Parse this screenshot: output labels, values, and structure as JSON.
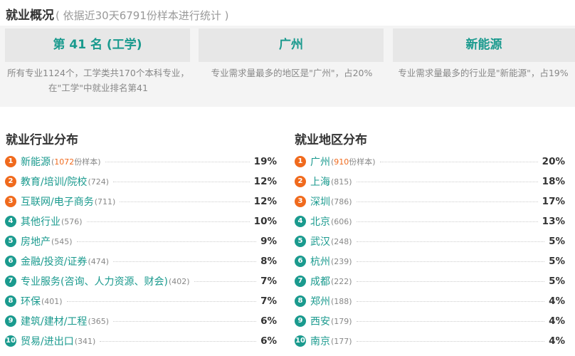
{
  "header": {
    "title": "就业概况",
    "subtitle": "( 依据近30天6791份样本进行统计 )"
  },
  "summary": {
    "cards": [
      {
        "value": "第 41 名 (工学)",
        "desc": "所有专业1124个，工学类共170个本科专业，在\"工学\"中就业排名第41"
      },
      {
        "value": "广州",
        "desc": "专业需求量最多的地区是\"广州\"，占20%"
      },
      {
        "value": "新能源",
        "desc": "专业需求量最多的行业是\"新能源\"，占19%"
      }
    ]
  },
  "industry": {
    "title": "就业行业分布",
    "items": [
      {
        "rank": "1",
        "name": "新能源",
        "count_num": "1072",
        "count_suffix": "份样本",
        "pct": "19%"
      },
      {
        "rank": "2",
        "name": "教育/培训/院校",
        "count": "(724)",
        "pct": "12%"
      },
      {
        "rank": "3",
        "name": "互联网/电子商务",
        "count": "(711)",
        "pct": "12%"
      },
      {
        "rank": "4",
        "name": "其他行业",
        "count": "(576)",
        "pct": "10%"
      },
      {
        "rank": "5",
        "name": "房地产",
        "count": "(545)",
        "pct": "9%"
      },
      {
        "rank": "6",
        "name": "金融/投资/证券",
        "count": "(474)",
        "pct": "8%"
      },
      {
        "rank": "7",
        "name": "专业服务(咨询、人力资源、财会)",
        "count": "(402)",
        "pct": "7%"
      },
      {
        "rank": "8",
        "name": "环保",
        "count": "(401)",
        "pct": "7%"
      },
      {
        "rank": "9",
        "name": "建筑/建材/工程",
        "count": "(365)",
        "pct": "6%"
      },
      {
        "rank": "10",
        "name": "贸易/进出口",
        "count": "(341)",
        "pct": "6%"
      }
    ]
  },
  "region": {
    "title": "就业地区分布",
    "items": [
      {
        "rank": "1",
        "name": "广州",
        "count_num": "910",
        "count_suffix": "份样本",
        "pct": "20%"
      },
      {
        "rank": "2",
        "name": "上海",
        "count": "(815)",
        "pct": "18%"
      },
      {
        "rank": "3",
        "name": "深圳",
        "count": "(786)",
        "pct": "17%"
      },
      {
        "rank": "4",
        "name": "北京",
        "count": "(606)",
        "pct": "13%"
      },
      {
        "rank": "5",
        "name": "武汉",
        "count": "(248)",
        "pct": "5%"
      },
      {
        "rank": "6",
        "name": "杭州",
        "count": "(239)",
        "pct": "5%"
      },
      {
        "rank": "7",
        "name": "成都",
        "count": "(222)",
        "pct": "5%"
      },
      {
        "rank": "8",
        "name": "郑州",
        "count": "(188)",
        "pct": "4%"
      },
      {
        "rank": "9",
        "name": "西安",
        "count": "(179)",
        "pct": "4%"
      },
      {
        "rank": "10",
        "name": "南京",
        "count": "(177)",
        "pct": "4%"
      }
    ]
  },
  "colors": {
    "accent_teal": "#1a9a8e",
    "accent_orange": "#f06a1d"
  }
}
